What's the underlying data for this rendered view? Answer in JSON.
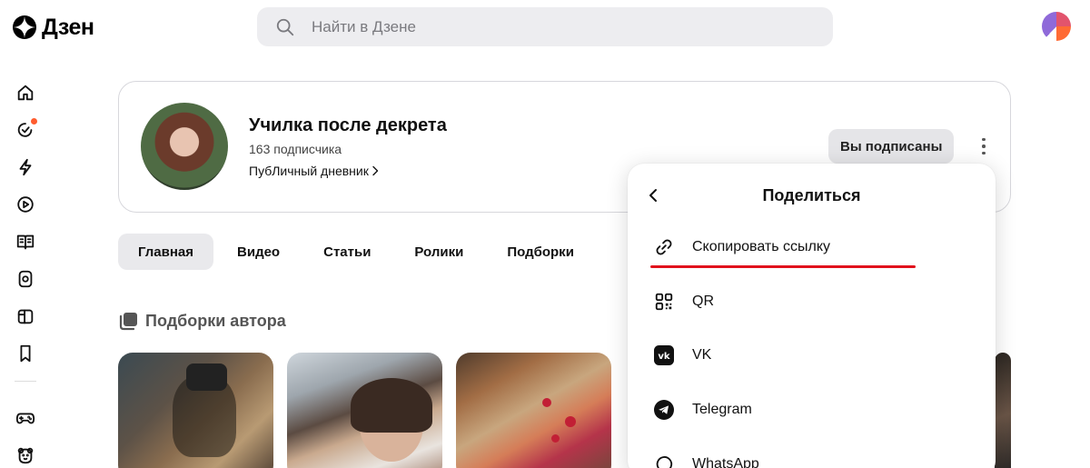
{
  "header": {
    "logo_text": "Дзен",
    "search_placeholder": "Найти в Дзене"
  },
  "rail": {
    "items": [
      "home-icon",
      "subscriptions-icon",
      "lightning-icon",
      "video-icon",
      "articles-icon",
      "shorts-icon",
      "collections-icon",
      "bookmark-icon",
      "games-icon",
      "kids-icon"
    ],
    "notification_dot_color": "#ff5c2e"
  },
  "channel": {
    "title": "Училка после декрета",
    "subscribers": "163 подписчика",
    "description": "ПубЛичный дневник",
    "subscribed_label": "Вы подписаны"
  },
  "tabs": [
    {
      "label": "Главная",
      "active": true
    },
    {
      "label": "Видео",
      "active": false
    },
    {
      "label": "Статьи",
      "active": false
    },
    {
      "label": "Ролики",
      "active": false
    },
    {
      "label": "Подборки",
      "active": false
    }
  ],
  "section": {
    "title": "Подборки автора"
  },
  "share": {
    "title": "Поделиться",
    "items": [
      {
        "label": "Скопировать ссылку",
        "icon": "link-icon"
      },
      {
        "label": "QR",
        "icon": "qr-icon"
      },
      {
        "label": "VK",
        "icon": "vk-icon"
      },
      {
        "label": "Telegram",
        "icon": "telegram-icon"
      },
      {
        "label": "WhatsApp",
        "icon": "whatsapp-icon"
      }
    ],
    "highlight_color": "#e1121c"
  }
}
